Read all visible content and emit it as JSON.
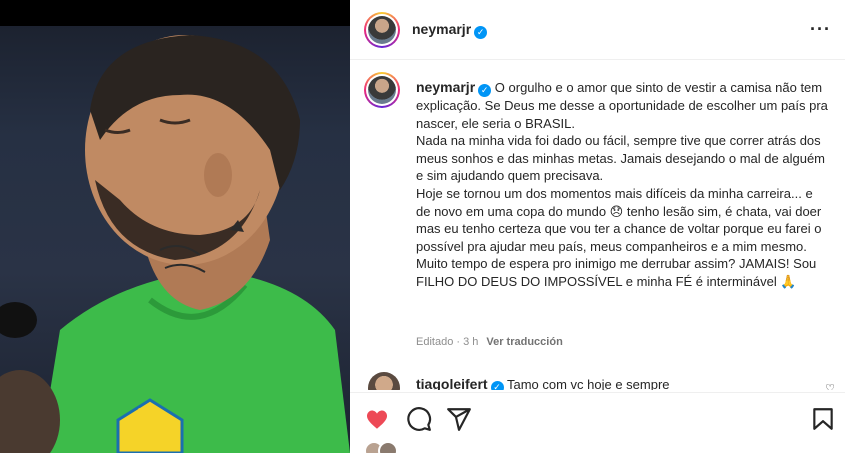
{
  "post": {
    "username": "neymarjr",
    "verified_glyph": "✓",
    "more_glyph": "···",
    "caption": {
      "username": "neymarjr",
      "paragraphs": [
        "O orgulho e o amor que sinto de vestir a camisa não tem explicação. Se Deus me desse a oportunidade de escolher um país pra nascer, ele seria o BRASIL.",
        "Nada na minha vida foi dado ou fácil, sempre tive que correr atrás dos meus sonhos e das minhas metas. Jamais desejando o mal de alguém e sim ajudando quem precisava.",
        "Hoje se tornou um dos momentos mais difíceis da minha carreira... e de novo em uma copa do mundo 😞 tenho lesão sim, é chata, vai doer mas eu tenho certeza que vou ter a chance de voltar porque eu farei o possível pra ajudar meu país, meus companheiros e a mim mesmo.",
        "Muito tempo de espera pro inimigo me derrubar assim? JAMAIS! Sou FILHO DO DEUS DO IMPOSSÍVEL e minha FÉ é interminável 🙏"
      ]
    },
    "meta": {
      "edited": "Editado · 3 h",
      "translate": "Ver traducción"
    },
    "comment": {
      "username": "tiagoleifert",
      "text": "Tamo com vc hoje e sempre",
      "heart_glyph": "♡"
    },
    "actions": {
      "like": "heart-icon",
      "comment": "comment-icon",
      "share": "share-icon",
      "save": "bookmark-icon",
      "like_color": "#ed4956"
    }
  }
}
